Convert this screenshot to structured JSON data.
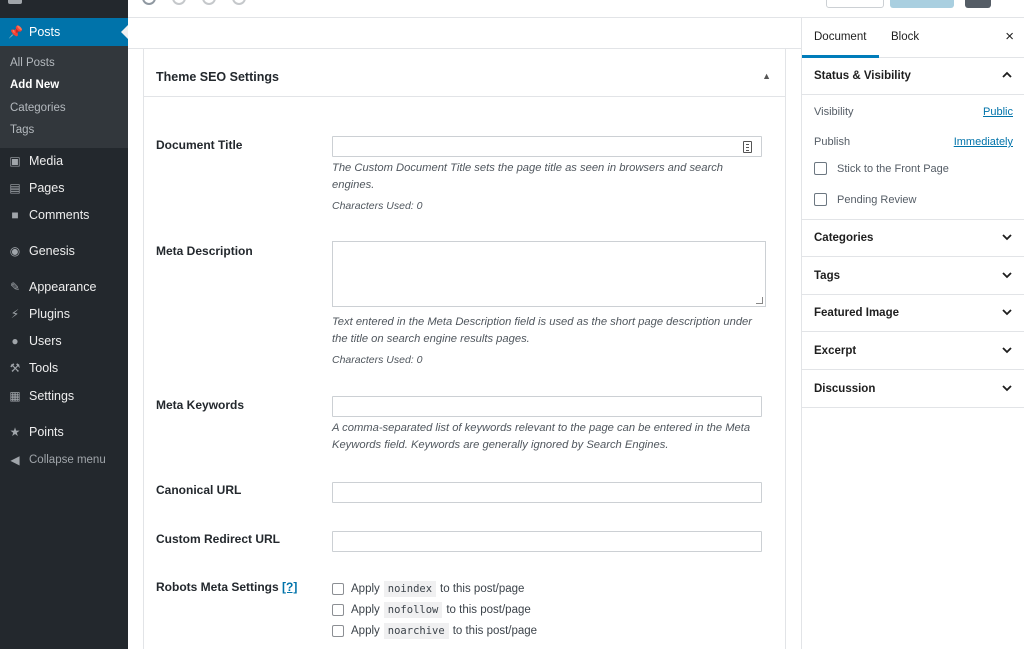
{
  "admin_menu": {
    "posts": "Posts",
    "submenu": [
      "All Posts",
      "Add New",
      "Categories",
      "Tags"
    ],
    "items": [
      {
        "label": "Media",
        "icon": "media-icon"
      },
      {
        "label": "Pages",
        "icon": "pages-icon"
      },
      {
        "label": "Comments",
        "icon": "comments-icon"
      },
      {
        "label": "Genesis",
        "icon": "genesis-icon"
      },
      {
        "label": "Appearance",
        "icon": "appearance-icon"
      },
      {
        "label": "Plugins",
        "icon": "plugins-icon"
      },
      {
        "label": "Users",
        "icon": "users-icon"
      },
      {
        "label": "Tools",
        "icon": "tools-icon"
      },
      {
        "label": "Settings",
        "icon": "settings-icon"
      },
      {
        "label": "Points",
        "icon": "star-icon"
      }
    ],
    "collapse": "Collapse menu"
  },
  "seo": {
    "title": "Theme SEO Settings",
    "doc_title": {
      "label": "Document Title",
      "value": "",
      "desc": "The Custom Document Title sets the page title as seen in browsers and search engines.",
      "counter": "Characters Used: 0"
    },
    "meta_desc": {
      "label": "Meta Description",
      "value": "",
      "desc": "Text entered in the Meta Description field is used as the short page description under the title on search engine results pages.",
      "counter": "Characters Used: 0"
    },
    "meta_keywords": {
      "label": "Meta Keywords",
      "value": "",
      "desc": "A comma-separated list of keywords relevant to the page can be entered in the Meta Keywords field. Keywords are generally ignored by Search Engines."
    },
    "canonical": {
      "label": "Canonical URL",
      "value": ""
    },
    "redirect": {
      "label": "Custom Redirect URL",
      "value": ""
    },
    "robots": {
      "label": "Robots Meta Settings",
      "help": "[?]",
      "options": [
        {
          "pre": "Apply",
          "code": "noindex",
          "post": "to this post/page"
        },
        {
          "pre": "Apply",
          "code": "nofollow",
          "post": "to this post/page"
        },
        {
          "pre": "Apply",
          "code": "noarchive",
          "post": "to this post/page"
        }
      ]
    }
  },
  "sidebar": {
    "tabs": [
      "Document",
      "Block"
    ],
    "close": "×",
    "status": {
      "title": "Status & Visibility",
      "visibility_label": "Visibility",
      "visibility_value": "Public",
      "publish_label": "Publish",
      "publish_value": "Immediately",
      "stick": "Stick to the Front Page",
      "pending": "Pending Review"
    },
    "panels": [
      "Categories",
      "Tags",
      "Featured Image",
      "Excerpt",
      "Discussion"
    ]
  },
  "colors": {
    "admin_bg": "#23282d",
    "admin_active": "#0073aa",
    "link": "#0073aa",
    "tab_underline": "#007cba"
  }
}
